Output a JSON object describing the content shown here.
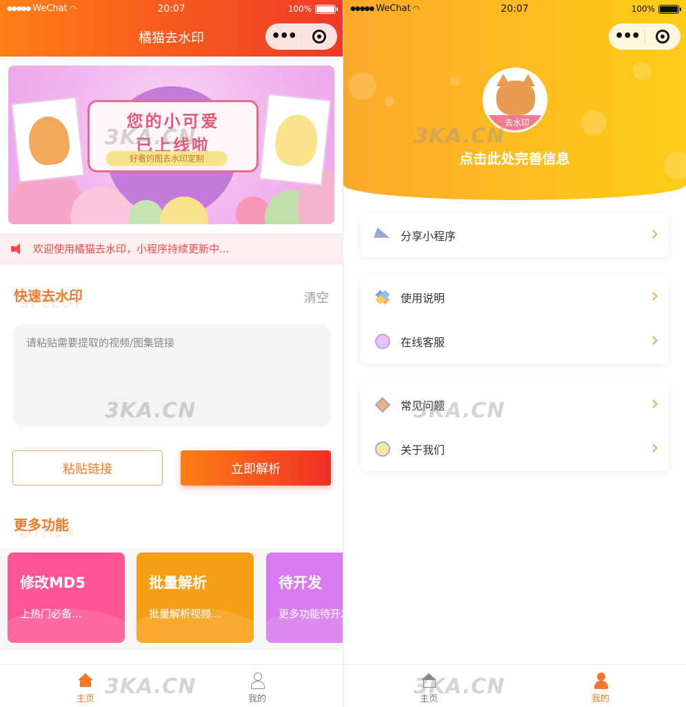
{
  "left": {
    "status": {
      "carrier": "WeChat",
      "time": "20:07",
      "battery": "100%"
    },
    "nav_title": "橘猫去水印",
    "banner": {
      "line1": "您的小可爱",
      "line2": "已上线啦",
      "tagline": "好看的图去水印定制"
    },
    "notice": "欢迎使用橘猫去水印，小程序持续更新中...",
    "quick": {
      "title": "快速去水印",
      "subtitle": "SPEEDY",
      "clear_label": "清空",
      "placeholder": "请粘贴需要提取的视频/图集链接"
    },
    "buttons": {
      "paste": "粘贴链接",
      "parse": "立即解析"
    },
    "more": {
      "title": "更多功能",
      "subtitle": "OTHER"
    },
    "cards": [
      {
        "title": "修改MD5",
        "desc": "上热门必备...",
        "color": "#ff5592"
      },
      {
        "title": "批量解析",
        "desc": "批量解析视频...",
        "color": "#f69e14"
      },
      {
        "title": "待开发",
        "desc": "更多功能待开发",
        "color": "#d77bee"
      }
    ],
    "tabs": [
      {
        "label": "主页"
      },
      {
        "label": "我的"
      }
    ]
  },
  "right": {
    "status": {
      "carrier": "WeChat",
      "time": "20:07",
      "battery": "100%"
    },
    "avatar_label": "去水印",
    "profile_prompt": "点击此处完善信息",
    "groups": [
      [
        {
          "label": "分享小程序",
          "icon": "paper-plane-icon"
        }
      ],
      [
        {
          "label": "使用说明",
          "icon": "pinwheel-icon"
        },
        {
          "label": "在线客服",
          "icon": "customer-service-icon"
        }
      ],
      [
        {
          "label": "常见问题",
          "icon": "kite-icon"
        },
        {
          "label": "关于我们",
          "icon": "about-icon"
        }
      ]
    ],
    "tabs": [
      {
        "label": "主页"
      },
      {
        "label": "我的"
      }
    ]
  },
  "watermark": "3KA.CN",
  "colors": {
    "accent_orange": "#f5782a",
    "header_red": "#ef3a28",
    "header_yellow": "#fdbf1f"
  }
}
